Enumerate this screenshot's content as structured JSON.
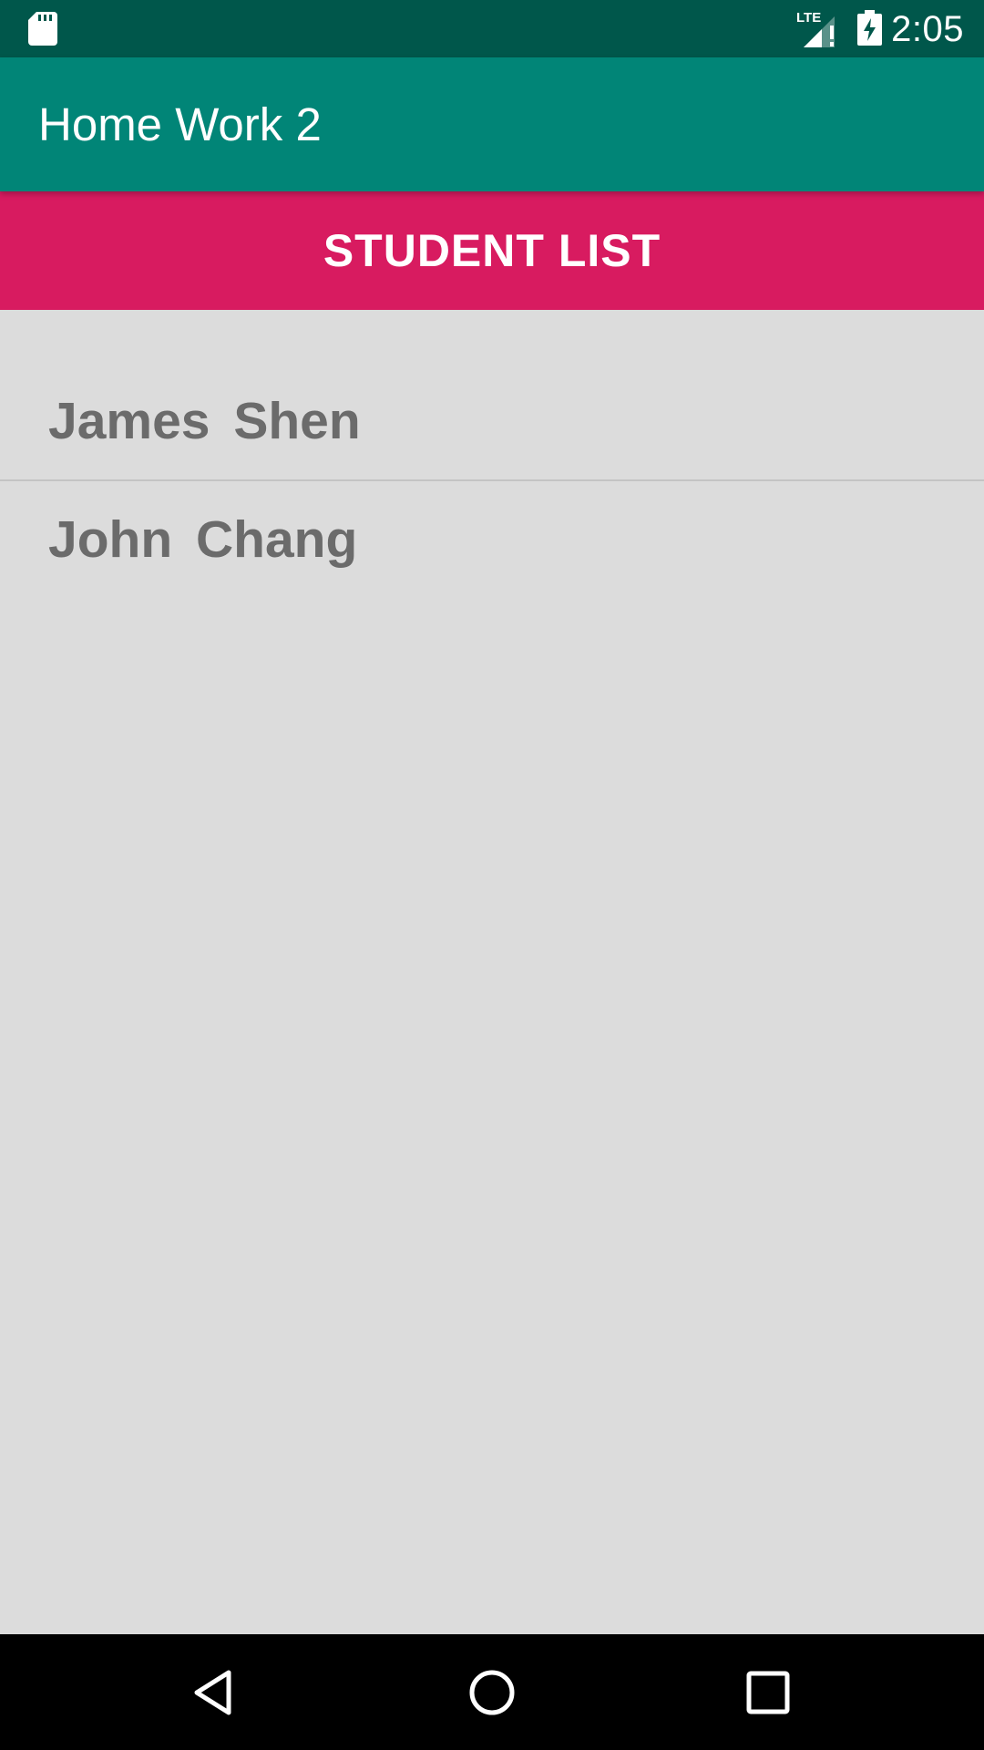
{
  "status_bar": {
    "time": "2:05",
    "network_label": "LTE",
    "icons": [
      "sd-card-icon",
      "lte-signal-icon",
      "battery-charging-icon"
    ]
  },
  "app_bar": {
    "title": "Home Work 2"
  },
  "main": {
    "button_label": "STUDENT LIST",
    "students": [
      {
        "name": "James  Shen"
      },
      {
        "name": "John  Chang"
      }
    ]
  },
  "nav_bar": {
    "icons": [
      "back-icon",
      "home-icon",
      "recents-icon"
    ]
  },
  "colors": {
    "status_bar": "#00574b",
    "app_bar": "#018577",
    "accent": "#d81b60",
    "background": "#dcdcdc",
    "list_text": "#6b6b6b"
  }
}
